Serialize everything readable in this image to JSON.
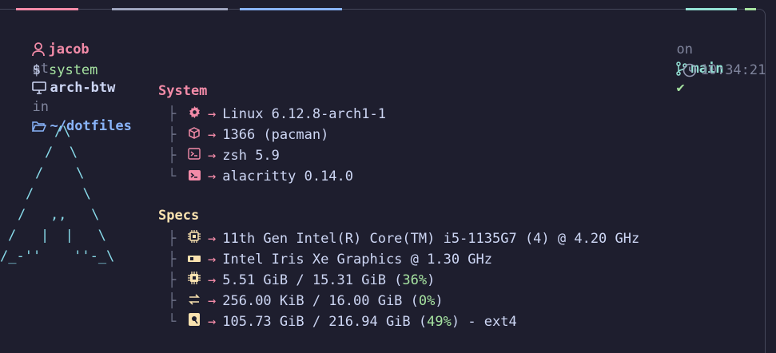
{
  "prompt": {
    "user": "jacob",
    "at": "at",
    "host": "arch-btw",
    "in": "in",
    "dir": "~/dotfiles",
    "on": "on",
    "branch": "main",
    "status_glyph": "✔",
    "symbol": "$",
    "command": "system",
    "time": "10:34:21"
  },
  "ascii_logo": "    /\\\n   /  \\\n  /    \\\n /      \\\n/   ,,   \\\n/   |  |   \\\n/_-''    ''-_\\",
  "system": {
    "title": "System",
    "items": [
      {
        "icon": "gear-icon",
        "text": "Linux 6.12.8-arch1-1"
      },
      {
        "icon": "package-icon",
        "text": "1366 (pacman)"
      },
      {
        "icon": "shell-icon",
        "text": "zsh 5.9"
      },
      {
        "icon": "terminal-icon",
        "text": "alacritty 0.14.0"
      }
    ]
  },
  "specs": {
    "title": "Specs",
    "items": [
      {
        "icon": "cpu-icon",
        "text": "11th Gen Intel(R) Core(TM) i5-1135G7 (4) @ 4.20 GHz"
      },
      {
        "icon": "gpu-icon",
        "text": "Intel Iris Xe Graphics @ 1.30 GHz"
      },
      {
        "icon": "memory-icon",
        "pre": "5.51 GiB / 15.31 GiB (",
        "pct": "36%",
        "post": ")"
      },
      {
        "icon": "swap-icon",
        "pre": "256.00 KiB / 16.00 GiB (",
        "pct": "0%",
        "post": ")"
      },
      {
        "icon": "disk-icon",
        "pre": "105.73 GiB / 216.94 GiB (",
        "pct": "49%",
        "post": ") - ext4"
      }
    ]
  },
  "colors": {
    "background": "#1e1e2e",
    "pink": "#f38ba8",
    "blue": "#89b4fa",
    "teal": "#94e2d5",
    "yellow": "#f9e2af",
    "green": "#a6e3a1"
  }
}
